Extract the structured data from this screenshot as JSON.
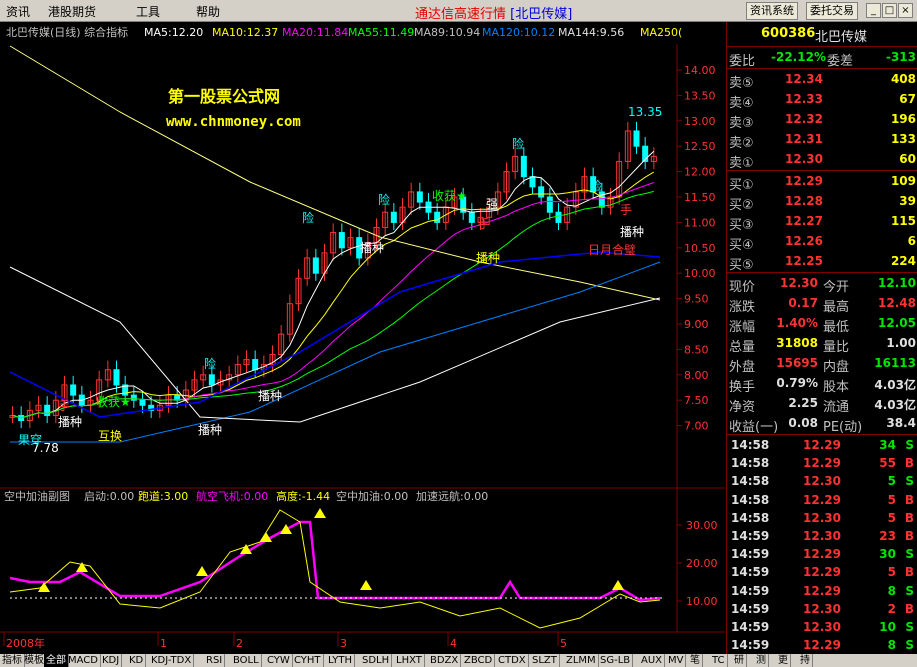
{
  "menu": {
    "items": [
      "资讯",
      "港股期货",
      "工具",
      "帮助"
    ],
    "app_title": "通达信高速行情",
    "app_stock": "[北巴传媒]",
    "sys_buttons": [
      "资讯系统",
      "委托交易"
    ],
    "win_buttons": [
      "_",
      "□",
      "×"
    ]
  },
  "chart": {
    "header": {
      "stock": "北巴传媒(日线) 综合指标",
      "ma5": "MA5:12.20",
      "ma10": "MA10:12.37",
      "ma20": "MA20:11.84",
      "ma55": "MA55:11.49",
      "ma89": "MA89:10.94",
      "ma120": "MA120:10.12",
      "ma144": "MA144:9.56",
      "ma250": "MA250("
    },
    "watermark": {
      "title": "第一股票公式网",
      "url": "www.chnmoney.com"
    },
    "price_axis": [
      "14.00",
      "13.50",
      "13.00",
      "12.50",
      "12.00",
      "11.50",
      "11.00",
      "10.50",
      "10.00",
      "9.50",
      "9.00",
      "8.50",
      "8.00",
      "7.50",
      "7.00"
    ],
    "annotations": [
      "13.35",
      "险",
      "险",
      "险",
      "险",
      "险",
      "收获★",
      "收获★",
      "强",
      "手",
      "手",
      "手",
      "播种",
      "播种",
      "播种",
      "播种",
      "播种",
      "播种",
      "日月合璧",
      "互换",
      "7.78",
      "果穿"
    ],
    "sub_header": {
      "title": "空中加油副图",
      "qidong": "启动:0.00",
      "paodao": "跑道:3.00",
      "hangkong": "航空飞机:0.00",
      "gaodu": "高度:-1.44",
      "jiayou": "空中加油:0.00",
      "yuanhang": "加速远航:0.00"
    },
    "sub_axis": [
      "30.00",
      "20.00",
      "10.00"
    ],
    "date_axis": [
      "2008年",
      "1",
      "2",
      "3",
      "4",
      "5"
    ],
    "colors": {
      "ma5": "#ffffff",
      "ma10": "#ffff00",
      "ma20": "#ff00ff",
      "ma55": "#00ff00",
      "ma89": "#c0c0c0",
      "ma120": "#0080ff",
      "ma144": "#e0e0e0",
      "up": "#ff3232",
      "down": "#00ffff",
      "magenta": "#ff00ff",
      "yellow": "#ffff00"
    }
  },
  "quote": {
    "code": "600386",
    "name": "北巴传媒",
    "weibi_label": "委比",
    "weibi": "-22.12%",
    "weicha_label": "委差",
    "weicha": "-313",
    "sell": [
      {
        "label": "卖⑤",
        "price": "12.34",
        "vol": "408"
      },
      {
        "label": "卖④",
        "price": "12.33",
        "vol": "67"
      },
      {
        "label": "卖③",
        "price": "12.32",
        "vol": "196"
      },
      {
        "label": "卖②",
        "price": "12.31",
        "vol": "133"
      },
      {
        "label": "卖①",
        "price": "12.30",
        "vol": "60"
      }
    ],
    "buy": [
      {
        "label": "买①",
        "price": "12.29",
        "vol": "109"
      },
      {
        "label": "买②",
        "price": "12.28",
        "vol": "39"
      },
      {
        "label": "买③",
        "price": "12.27",
        "vol": "115"
      },
      {
        "label": "买④",
        "price": "12.26",
        "vol": "6"
      },
      {
        "label": "买⑤",
        "price": "12.25",
        "vol": "224"
      }
    ],
    "stats": [
      {
        "l1": "现价",
        "v1": "12.30",
        "l2": "今开",
        "v2": "12.10",
        "c1": "red",
        "c2": "green"
      },
      {
        "l1": "涨跌",
        "v1": "0.17",
        "l2": "最高",
        "v2": "12.48",
        "c1": "red",
        "c2": "red"
      },
      {
        "l1": "涨幅",
        "v1": "1.40%",
        "l2": "最低",
        "v2": "12.05",
        "c1": "red",
        "c2": "green"
      },
      {
        "l1": "总量",
        "v1": "31808",
        "l2": "量比",
        "v2": "1.00",
        "c1": "yellow",
        "c2": "white"
      },
      {
        "l1": "外盘",
        "v1": "15695",
        "l2": "内盘",
        "v2": "16113",
        "c1": "red",
        "c2": "green"
      },
      {
        "l1": "换手",
        "v1": "0.79%",
        "l2": "股本",
        "v2": "4.03亿",
        "c1": "white",
        "c2": "white"
      },
      {
        "l1": "净资",
        "v1": "2.25",
        "l2": "流通",
        "v2": "4.03亿",
        "c1": "white",
        "c2": "white"
      },
      {
        "l1": "收益(一)",
        "v1": "0.08",
        "l2": "PE(动)",
        "v2": "38.4",
        "c1": "white",
        "c2": "white"
      }
    ],
    "ticks": [
      {
        "time": "14:58",
        "price": "12.29",
        "vol": "34",
        "bs": "S"
      },
      {
        "time": "14:58",
        "price": "12.29",
        "vol": "55",
        "bs": "B"
      },
      {
        "time": "14:58",
        "price": "12.30",
        "vol": "5",
        "bs": "S"
      },
      {
        "time": "14:58",
        "price": "12.29",
        "vol": "5",
        "bs": "B"
      },
      {
        "time": "14:58",
        "price": "12.30",
        "vol": "5",
        "bs": "B"
      },
      {
        "time": "14:59",
        "price": "12.30",
        "vol": "23",
        "bs": "B"
      },
      {
        "time": "14:59",
        "price": "12.29",
        "vol": "30",
        "bs": "S"
      },
      {
        "time": "14:59",
        "price": "12.29",
        "vol": "5",
        "bs": "B"
      },
      {
        "time": "14:59",
        "price": "12.29",
        "vol": "8",
        "bs": "S"
      },
      {
        "time": "14:59",
        "price": "12.30",
        "vol": "2",
        "bs": "B"
      },
      {
        "time": "14:59",
        "price": "12.30",
        "vol": "10",
        "bs": "S"
      },
      {
        "time": "14:59",
        "price": "12.29",
        "vol": "8",
        "bs": "S"
      }
    ]
  },
  "tabs": [
    "指标",
    "模板",
    "全部",
    "MACD",
    "KDJ",
    "KD",
    "KDJ-TDX",
    "RSI",
    "BOLL",
    "CYW",
    "CYHT",
    "LYTH",
    "SDLH",
    "LHXT",
    "BDZX",
    "ZBCD",
    "CTDX",
    "SLZT",
    "ZLMM",
    "SG-LB",
    "AUX",
    "MV",
    "笔",
    "TC",
    "研",
    "测",
    "更",
    "持"
  ]
}
